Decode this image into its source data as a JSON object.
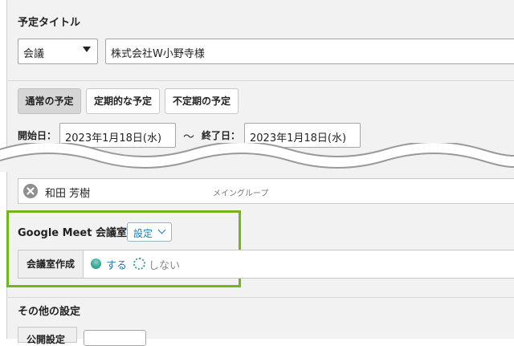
{
  "title_section": {
    "label": "予定タイトル",
    "category_select": "会議",
    "title_value": "株式会社W小野寺様"
  },
  "tabs": [
    {
      "label": "通常の予定",
      "active": true
    },
    {
      "label": "定期的な予定",
      "active": false
    },
    {
      "label": "不定期の予定",
      "active": false
    }
  ],
  "dates": {
    "start_label": "開始日：",
    "start_value": "2023年1月18日(水)",
    "separator": "～",
    "end_label": "終了日：",
    "end_value": "2023年1月18日(水)"
  },
  "member": {
    "name": "和田 芳樹",
    "group": "メイングループ"
  },
  "google_meet": {
    "title": "Google Meet 会議室",
    "settings_label": "設定",
    "room_label": "会議室作成",
    "option_yes": "する",
    "option_no": "しない",
    "selected": "する"
  },
  "other": {
    "title": "その他の設定",
    "row_label": "公開設定"
  },
  "colors": {
    "highlight": "#72b61b",
    "link": "#1b7db0",
    "radio": "#3aa493"
  }
}
